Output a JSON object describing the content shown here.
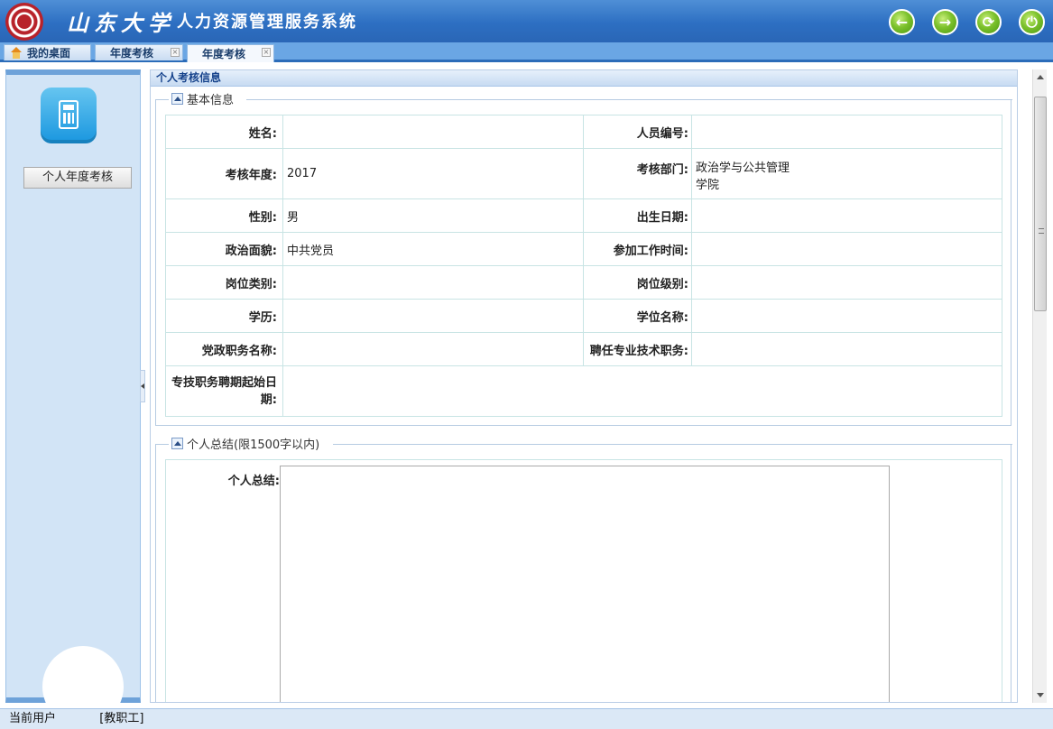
{
  "header": {
    "brand_calligraphy": "山东大学",
    "system_title": "人力资源管理服务系统",
    "buttons": {
      "back": "←",
      "forward": "→",
      "refresh": "⟳",
      "power": "⏻"
    }
  },
  "tabs": [
    {
      "label": "我的桌面"
    },
    {
      "label": "年度考核"
    },
    {
      "label": "年度考核"
    }
  ],
  "sidebar": {
    "item_label": "个人年度考核"
  },
  "panel": {
    "title": "个人考核信息"
  },
  "basic_info": {
    "legend": "基本信息",
    "rows": [
      {
        "l1": "姓名:",
        "v1": "",
        "l2": "人员编号:",
        "v2": ""
      },
      {
        "l1": "考核年度:",
        "v1": "2017",
        "l2": "考核部门:",
        "v2": "政治学与公共管理\n学院"
      },
      {
        "l1": "性别:",
        "v1": "男",
        "l2": "出生日期:",
        "v2": ""
      },
      {
        "l1": "政治面貌:",
        "v1": "中共党员",
        "l2": "参加工作时间:",
        "v2": ""
      },
      {
        "l1": "岗位类别:",
        "v1": "",
        "l2": "岗位级别:",
        "v2": ""
      },
      {
        "l1": "学历:",
        "v1": "",
        "l2": "学位名称:",
        "v2": ""
      },
      {
        "l1": "党政职务名称:",
        "v1": "",
        "l2": "聘任专业技术职务:",
        "v2": ""
      },
      {
        "l1": "专技职务聘期起始日期:",
        "v1": ""
      }
    ]
  },
  "summary": {
    "legend": "个人总结(限1500字以内)",
    "label": "个人总结:",
    "value": ""
  },
  "status": {
    "prefix": "当前用户",
    "role": "[教职工]"
  },
  "colors": {
    "header_blue": "#2d6fc2",
    "accent_green": "#7cc12c",
    "panel_title": "#15428b"
  }
}
